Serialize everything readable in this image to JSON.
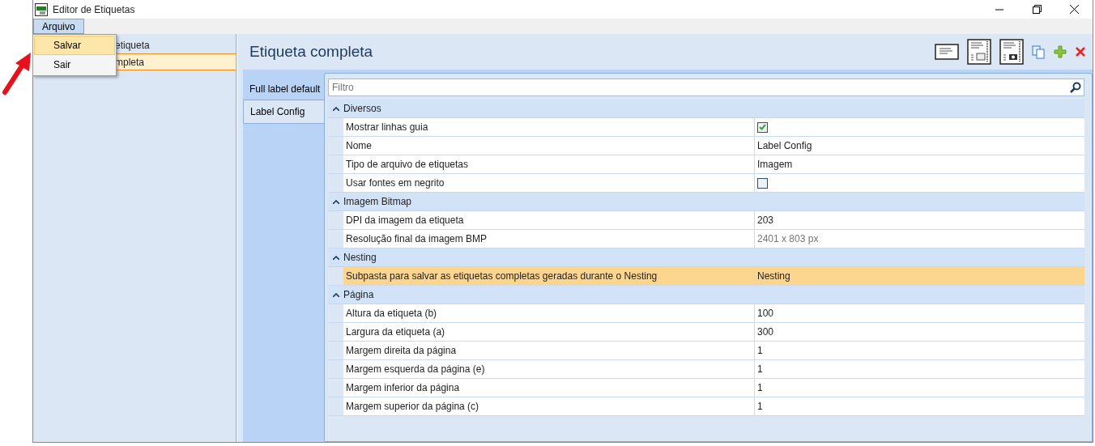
{
  "window": {
    "title": "Editor de Etiquetas"
  },
  "menu": [
    {
      "label": "Arquivo",
      "open": true,
      "items": [
        {
          "label": "Salvar",
          "selected": true
        },
        {
          "label": "Sair",
          "selected": false
        }
      ]
    }
  ],
  "tree": [
    {
      "label": "etiqueta",
      "selected": false
    },
    {
      "label": "mpleta",
      "selected": true
    }
  ],
  "panel_title": "Etiqueta completa",
  "tabs": [
    {
      "label": "Full label default",
      "selected": false
    },
    {
      "label": "Label Config",
      "selected": true
    }
  ],
  "filter": {
    "placeholder": "Filtro"
  },
  "categories": [
    {
      "name": "Diversos",
      "expanded": true,
      "rows": [
        {
          "name": "Mostrar linhas guia",
          "kind": "checkbox",
          "checked": true,
          "selected": false
        },
        {
          "name": "Nome",
          "kind": "text",
          "value": "Label Config",
          "readonly": false,
          "selected": false
        },
        {
          "name": "Tipo de arquivo de etiquetas",
          "kind": "text",
          "value": "Imagem",
          "readonly": false,
          "selected": false
        },
        {
          "name": "Usar fontes em negrito",
          "kind": "checkbox",
          "checked": false,
          "selected": false
        }
      ]
    },
    {
      "name": "Imagem Bitmap",
      "expanded": true,
      "rows": [
        {
          "name": "DPI da imagem da etiqueta",
          "kind": "text",
          "value": "203",
          "readonly": false,
          "selected": false
        },
        {
          "name": "Resolução final da imagem BMP",
          "kind": "text",
          "value": "2401 x 803 px",
          "readonly": true,
          "selected": false
        }
      ]
    },
    {
      "name": "Nesting",
      "expanded": true,
      "rows": [
        {
          "name": "Subpasta para salvar as etiquetas completas geradas durante o Nesting",
          "kind": "text",
          "value": "Nesting",
          "readonly": false,
          "selected": true
        }
      ]
    },
    {
      "name": "Página",
      "expanded": true,
      "rows": [
        {
          "name": "Altura da etiqueta (b)",
          "kind": "text",
          "value": "100",
          "readonly": false,
          "selected": false
        },
        {
          "name": "Largura da etiqueta (a)",
          "kind": "text",
          "value": "300",
          "readonly": false,
          "selected": false
        },
        {
          "name": "Margem direita da página",
          "kind": "text",
          "value": "1",
          "readonly": false,
          "selected": false
        },
        {
          "name": "Margem esquerda da página (e)",
          "kind": "text",
          "value": "1",
          "readonly": false,
          "selected": false
        },
        {
          "name": "Margem inferior da página",
          "kind": "text",
          "value": "1",
          "readonly": false,
          "selected": false
        },
        {
          "name": "Margem superior da página (c)",
          "kind": "text",
          "value": "1",
          "readonly": false,
          "selected": false
        }
      ]
    }
  ]
}
